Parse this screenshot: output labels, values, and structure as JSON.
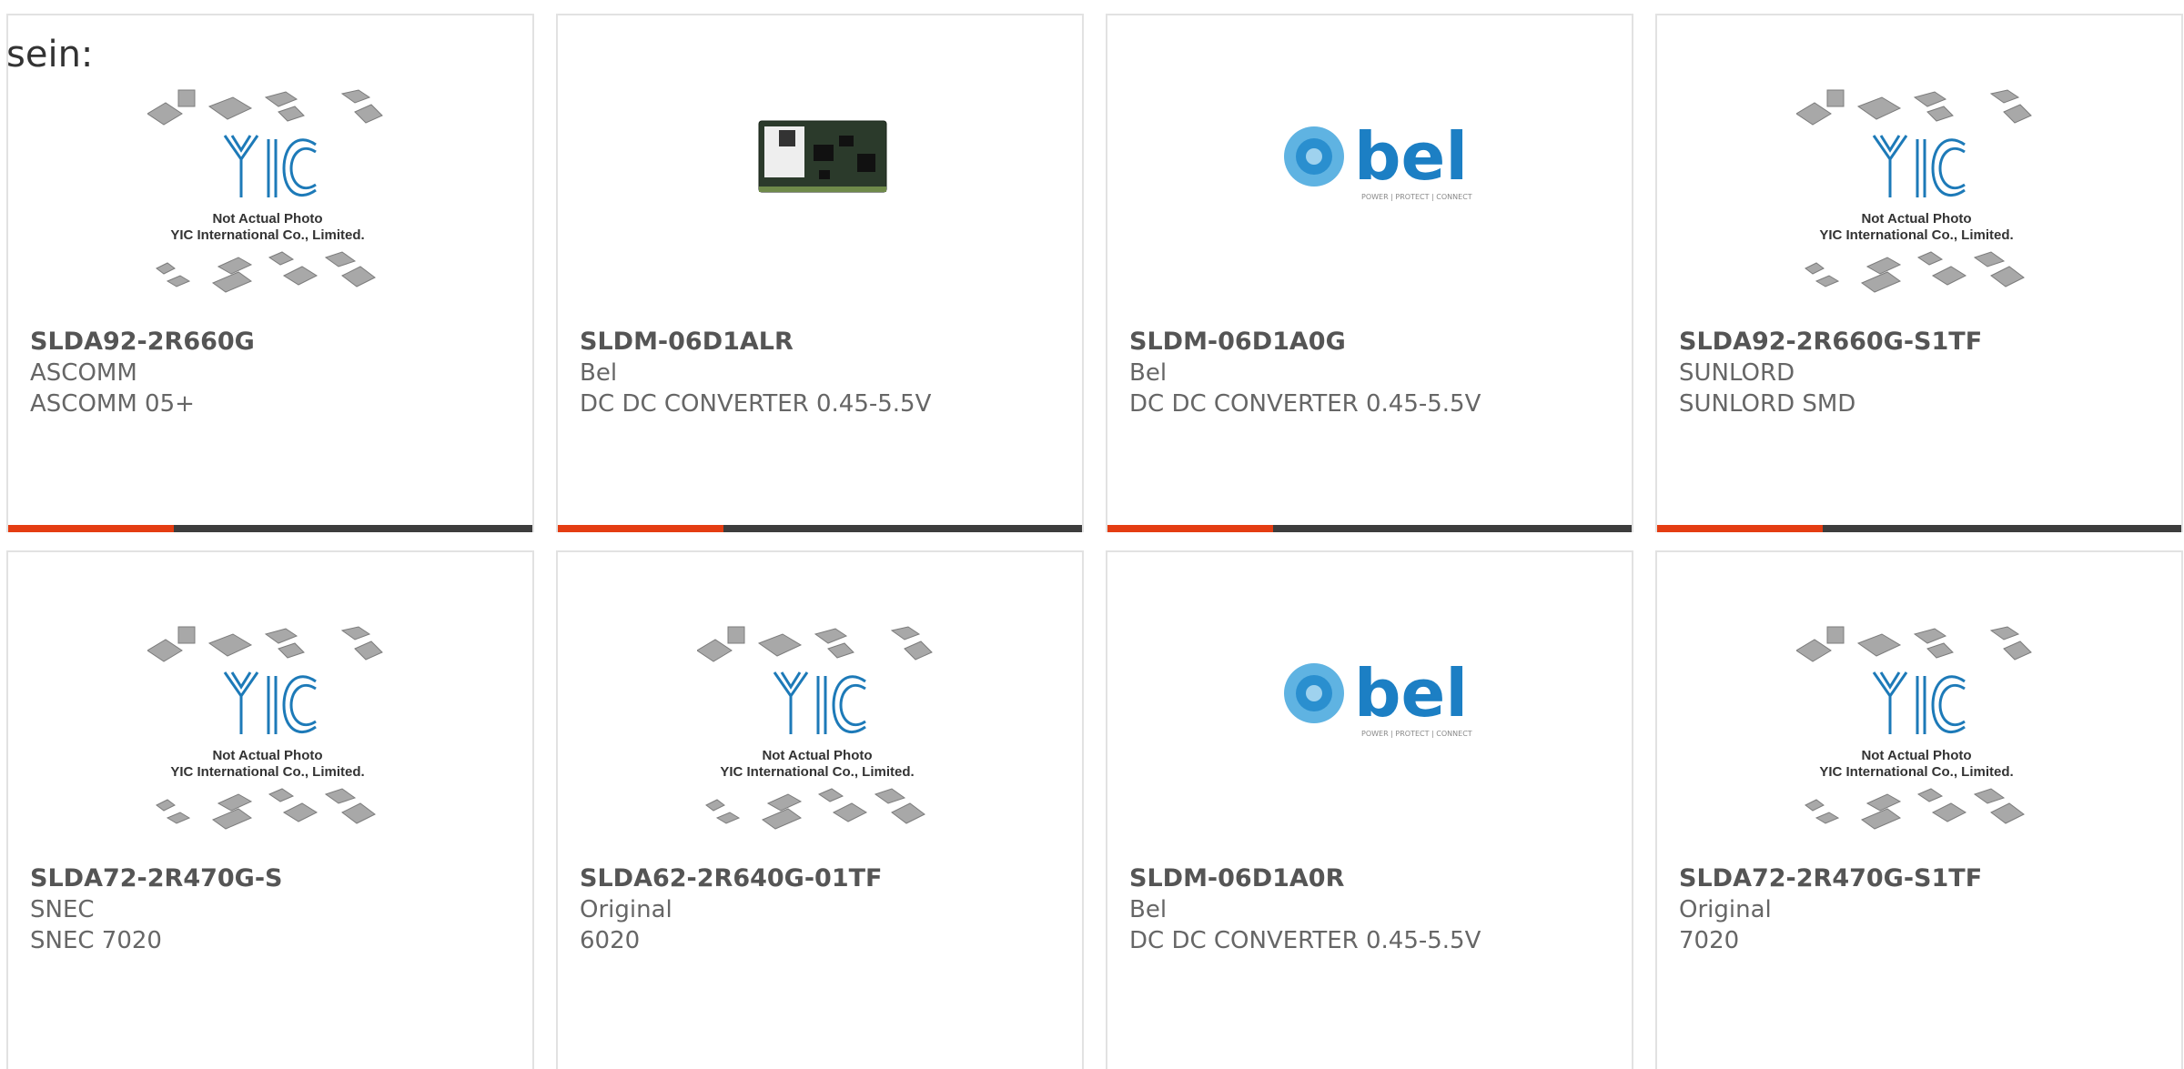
{
  "intro_text": "sein:",
  "colors": {
    "accent": "#e43d12",
    "bar": "#3d3d3d",
    "bel_blue": "#2a8fcf",
    "yic_blue": "#1d7ab8"
  },
  "placeholder_caption": {
    "line1": "Not Actual Photo",
    "line2": "YIC International Co., Limited."
  },
  "bel_logo": {
    "word": "bel",
    "tagline": "POWER | PROTECT | CONNECT"
  },
  "products": [
    {
      "part_number": "SLDA92-2R660G",
      "manufacturer": "ASCOMM",
      "description": "ASCOMM 05+",
      "image": "yic-placeholder"
    },
    {
      "part_number": "SLDM-06D1ALR",
      "manufacturer": "Bel",
      "description": "DC DC CONVERTER 0.45-5.5V",
      "image": "module-photo"
    },
    {
      "part_number": "SLDM-06D1A0G",
      "manufacturer": "Bel",
      "description": "DC DC CONVERTER 0.45-5.5V",
      "image": "bel-logo"
    },
    {
      "part_number": "SLDA92-2R660G-S1TF",
      "manufacturer": "SUNLORD",
      "description": "SUNLORD SMD",
      "image": "yic-placeholder"
    },
    {
      "part_number": "SLDA72-2R470G-S",
      "manufacturer": "SNEC",
      "description": "SNEC 7020",
      "image": "yic-placeholder"
    },
    {
      "part_number": "SLDA62-2R640G-01TF",
      "manufacturer": "Original",
      "description": "6020",
      "image": "yic-placeholder"
    },
    {
      "part_number": "SLDM-06D1A0R",
      "manufacturer": "Bel",
      "description": "DC DC CONVERTER 0.45-5.5V",
      "image": "bel-logo"
    },
    {
      "part_number": "SLDA72-2R470G-S1TF",
      "manufacturer": "Original",
      "description": "7020",
      "image": "yic-placeholder"
    }
  ]
}
